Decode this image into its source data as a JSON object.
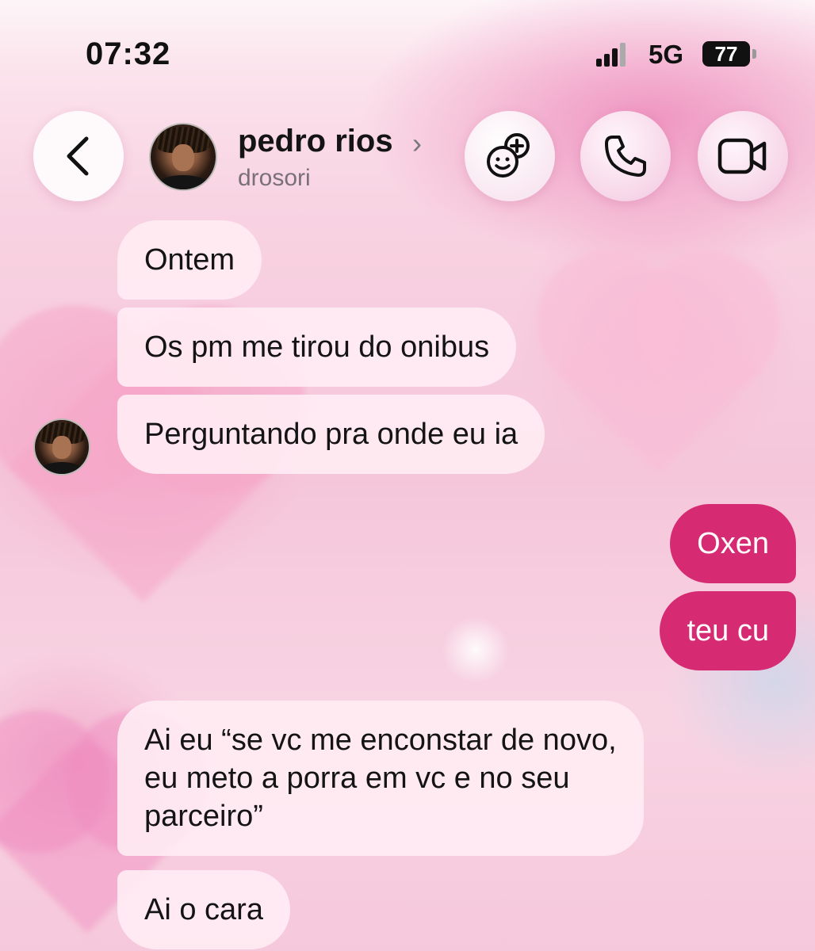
{
  "status_bar": {
    "time": "07:32",
    "network": "5G",
    "battery": "77"
  },
  "header": {
    "contact_name": "pedro rios",
    "username": "drosori",
    "back_icon": "chevron-left-icon",
    "buttons": {
      "chat_icon": "chat-bubbles-add-icon",
      "call_icon": "phone-icon",
      "video_icon": "video-camera-icon"
    }
  },
  "messages": [
    {
      "from": "them",
      "text": "Ontem"
    },
    {
      "from": "them",
      "text": "Os pm me tirou do onibus"
    },
    {
      "from": "them",
      "text": "Perguntando pra onde eu ia"
    },
    {
      "from": "me",
      "text": "Oxen"
    },
    {
      "from": "me",
      "text": "teu cu"
    },
    {
      "from": "them",
      "text": "Ai eu “se vc me enconstar de novo,\neu meto a porra em vc e no seu\nparceiro”"
    },
    {
      "from": "them",
      "text": "Ai o cara"
    }
  ],
  "colors": {
    "sent_bubble": "#d62b72",
    "received_bubble": "#ffecf3",
    "background": "#f5c6da"
  }
}
